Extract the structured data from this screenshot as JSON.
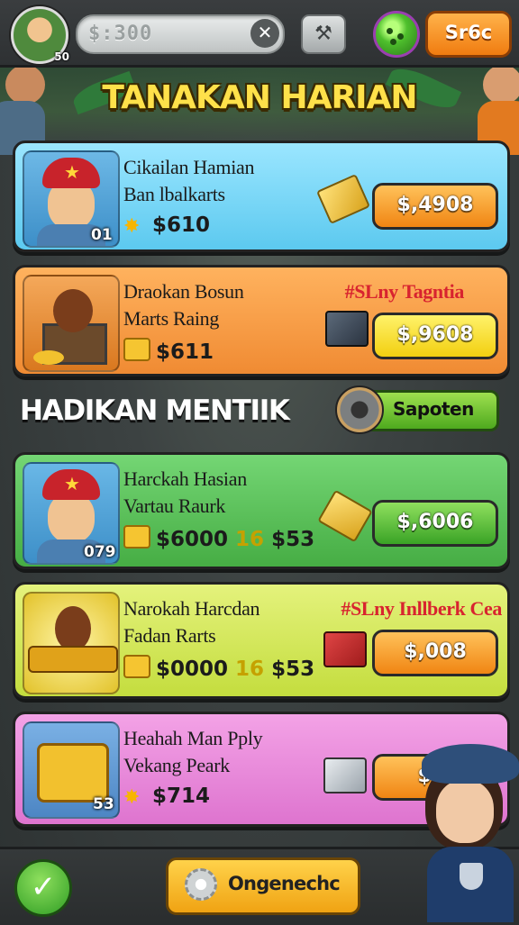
{
  "header": {
    "level": "50",
    "search_value": "$:300",
    "coin_button": "Sr6c",
    "colors": {
      "coin_button": "#f07c10",
      "gem": "#4fc02d"
    }
  },
  "title": "TANAKAN HARIAN",
  "daily_offers": [
    {
      "line1": "Cikailan Hamian",
      "line2": "Ban lbalkarts",
      "price": "$610",
      "badge": "01",
      "buy": "$,4908",
      "promo": "",
      "color": "#7fd8f6",
      "btn": "#f59a1a"
    },
    {
      "line1": "Draokan Bosun",
      "line2": "Marts Raing",
      "price": "$611",
      "badge": "",
      "buy": "$,9608",
      "promo": "#SLny Tagntia",
      "color": "#f59a3e",
      "btn": "#f7e11c"
    }
  ],
  "section": {
    "title": "HADIKAN MENTIIK",
    "sort_label": "Sapoten"
  },
  "offers": [
    {
      "line1": "Harckah Hasian",
      "line2": "Vartau Raurk",
      "price_a": "$6000",
      "price_mid": "16",
      "price_b": "$53",
      "badge": "079",
      "buy": "$,6006",
      "promo": "",
      "color": "#56bd57",
      "btn": "#4fb82b"
    },
    {
      "line1": "Narokah Harcdan",
      "line2": "Fadan Rarts",
      "price_a": "$0000",
      "price_mid": "16",
      "price_b": "$53",
      "badge": "",
      "buy": "$,008",
      "promo": "#SLny Inllberk Cea",
      "color": "#cfe45a",
      "btn": "#f59a1a"
    },
    {
      "line1": "Heahah Man Pply",
      "line2": "Vekang Peark",
      "price_a": "$714",
      "price_mid": "",
      "price_b": "",
      "badge": "53",
      "buy": "$,0",
      "promo": "",
      "color": "#e889d8",
      "btn": "#f59a1a"
    }
  ],
  "footer": {
    "main_button": "Ongenechc"
  },
  "icons": [
    "avatar",
    "search-clear-icon",
    "hammer-icon",
    "gem-icon",
    "coin-icon",
    "gear-icon",
    "check-icon",
    "gift-box-icon"
  ]
}
